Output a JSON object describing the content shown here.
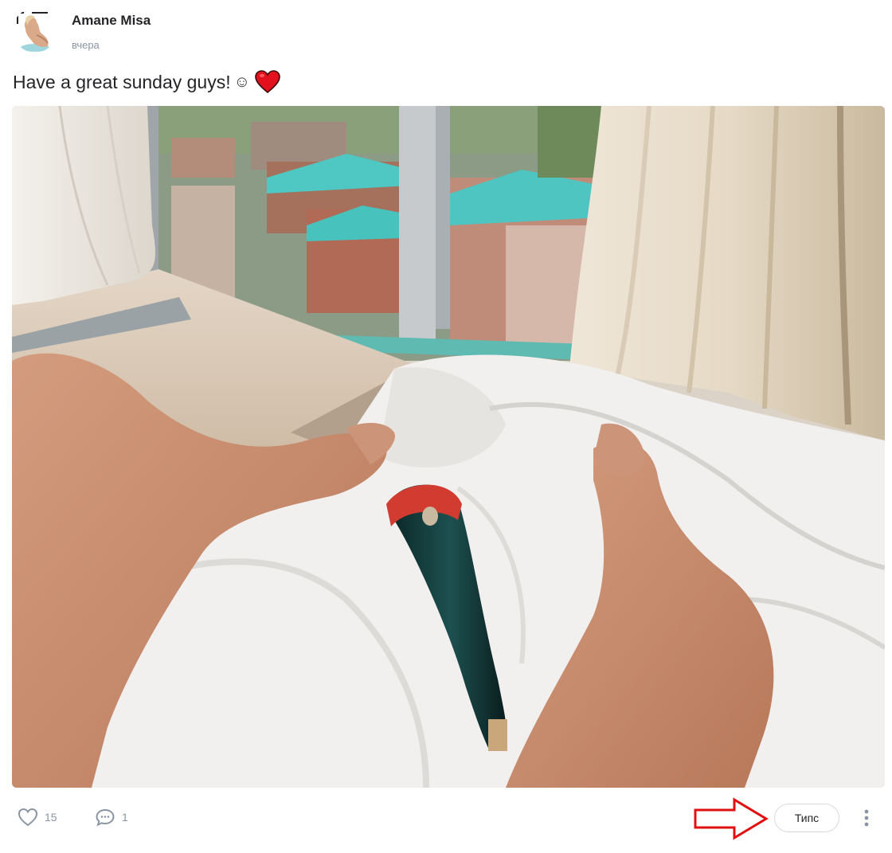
{
  "post": {
    "author": {
      "name": "Amane Misa",
      "avatar_icon": "avatar-photo"
    },
    "time": "вчера",
    "caption": {
      "text": "Have a great sunday guys!",
      "emojis": [
        "☺",
        "red-heart-icon"
      ]
    },
    "media": {
      "icon": "photo-bedroom-window"
    }
  },
  "footer": {
    "likes": {
      "icon": "heart-outline-icon",
      "count": "15"
    },
    "comments": {
      "icon": "comment-bubble-icon",
      "count": "1"
    },
    "tips_label": "Типс",
    "more_icon": "vertical-dots-icon",
    "annotation_icon": "red-arrow-icon"
  },
  "colors": {
    "muted": "#8a96a3",
    "text": "#242529",
    "annotation_red": "#e01010",
    "button_border": "#d6dbe0"
  }
}
